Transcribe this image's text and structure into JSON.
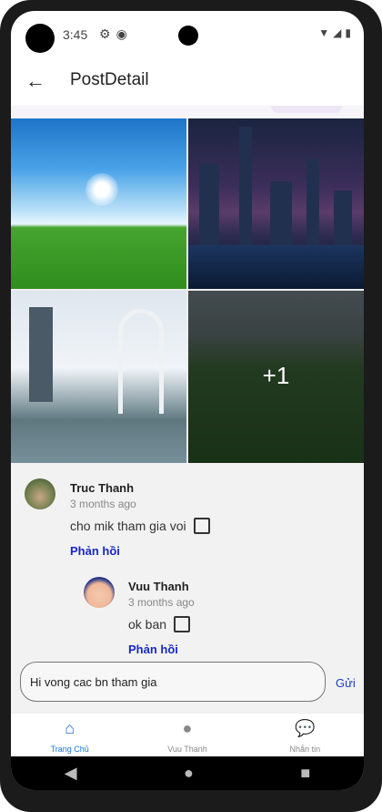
{
  "status": {
    "time": "3:45"
  },
  "app": {
    "title": "PostDetail"
  },
  "gallery": {
    "more_count": "+1"
  },
  "comments": [
    {
      "name": "Truc Thanh",
      "time": "3 months ago",
      "text": "cho mik tham gia voi",
      "reply": "Phản hồi"
    },
    {
      "name": "Vuu Thanh",
      "time": "3 months ago",
      "text": "ok ban",
      "reply": "Phản hồi"
    }
  ],
  "input": {
    "value": "Hi vong cac bn tham gia",
    "send_label": "Gửi"
  },
  "nav": [
    {
      "label": "Trang Chủ",
      "icon": "home-icon",
      "color": "#1a73e8"
    },
    {
      "label": "Vuu Thanh",
      "icon": "person-icon",
      "color": "#888888"
    },
    {
      "label": "Nhắn tin",
      "icon": "chat-icon",
      "color": "#888888"
    }
  ],
  "colors": {
    "accent": "#1a27c9",
    "nav_active": "#1a73e8"
  }
}
